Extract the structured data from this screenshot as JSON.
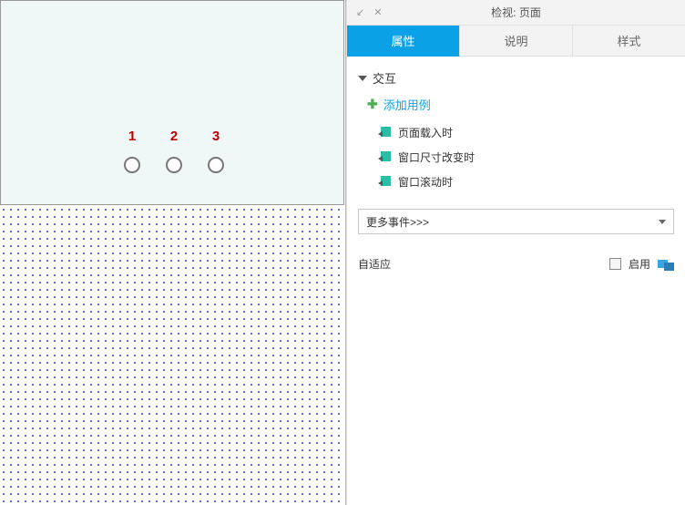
{
  "canvas": {
    "radios": [
      {
        "label": "1"
      },
      {
        "label": "2"
      },
      {
        "label": "3"
      }
    ]
  },
  "panel": {
    "title": "检视: 页面",
    "tabs": {
      "properties": "属性",
      "notes": "说明",
      "style": "样式"
    },
    "interactions": {
      "section_label": "交互",
      "add_case": "添加用例",
      "events": {
        "page_load": "页面载入时",
        "window_resize": "窗口尺寸改变时",
        "window_scroll": "窗口滚动时"
      },
      "more_events": "更多事件>>>"
    },
    "adaptive": {
      "label": "自适应",
      "enable": "启用"
    }
  }
}
